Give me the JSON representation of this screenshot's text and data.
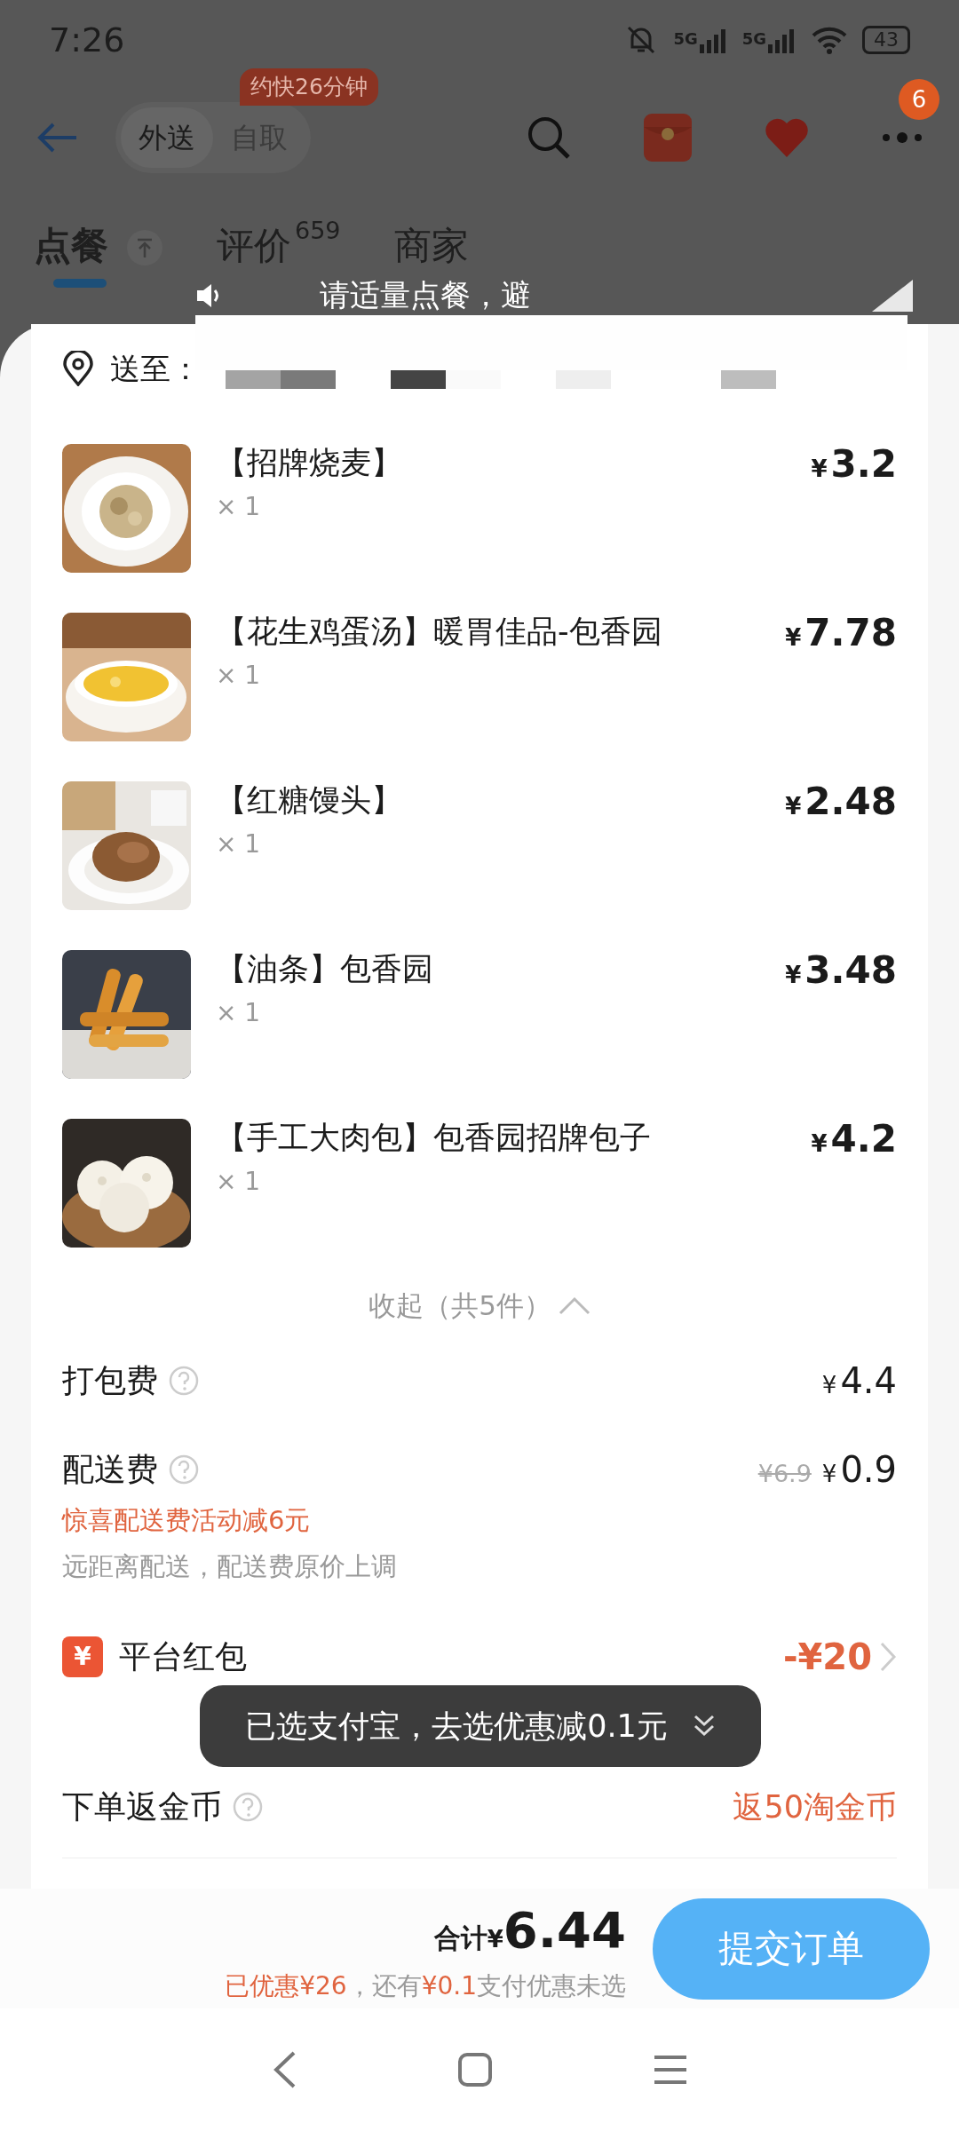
{
  "status_bar": {
    "time": "7:26",
    "network_1": "5G",
    "network_2": "5G",
    "battery": "43"
  },
  "header": {
    "eta_badge": "约快26分钟",
    "more_badge": "6"
  },
  "modes": [
    {
      "label": "外送",
      "selected": true
    },
    {
      "label": "自取",
      "selected": false
    }
  ],
  "tabs": [
    {
      "label": "点餐",
      "selected": true
    },
    {
      "label": "评价",
      "count": "659",
      "selected": false
    },
    {
      "label": "商家",
      "selected": false
    }
  ],
  "notice": "请适量点餐，避",
  "address": {
    "label": "送至："
  },
  "items": [
    {
      "name": "【招牌烧麦】",
      "qty": "× 1",
      "currency": "¥",
      "amount": "3.2",
      "kind": "shaomai"
    },
    {
      "name": "【花生鸡蛋汤】暖胃佳品-包香园",
      "qty": "× 1",
      "currency": "¥",
      "amount": "7.78",
      "kind": "soup"
    },
    {
      "name": "【红糖馒头】",
      "qty": "× 1",
      "currency": "¥",
      "amount": "2.48",
      "kind": "mantou"
    },
    {
      "name": "【油条】包香园",
      "qty": "× 1",
      "currency": "¥",
      "amount": "3.48",
      "kind": "youtiao"
    },
    {
      "name": "【手工大肉包】包香园招牌包子",
      "qty": "× 1",
      "currency": "¥",
      "amount": "4.2",
      "kind": "baozi"
    }
  ],
  "collapse": "收起（共5件）",
  "fees": [
    {
      "label": "打包费",
      "currency": "¥",
      "amount": "4.4"
    },
    {
      "label": "配送费",
      "original": "¥6.9",
      "currency": "¥",
      "amount": "0.9",
      "promo": "惊喜配送费活动减6元",
      "note": "远距离配送，配送费原价上调"
    }
  ],
  "red_packet": {
    "icon": "¥",
    "label": "平台红包",
    "value": "-¥20"
  },
  "coins": {
    "label": "下单返金币",
    "value": "返50淘金币"
  },
  "toast": "已选支付宝，去选优惠减0.1元",
  "footer": {
    "total_label": "合计",
    "currency": "¥",
    "total": "6.44",
    "saved": "已优惠¥26",
    "note_pre": "，还有",
    "note_amount": "¥0.1",
    "note_post": "支付优惠未选",
    "submit": "提交订单"
  }
}
